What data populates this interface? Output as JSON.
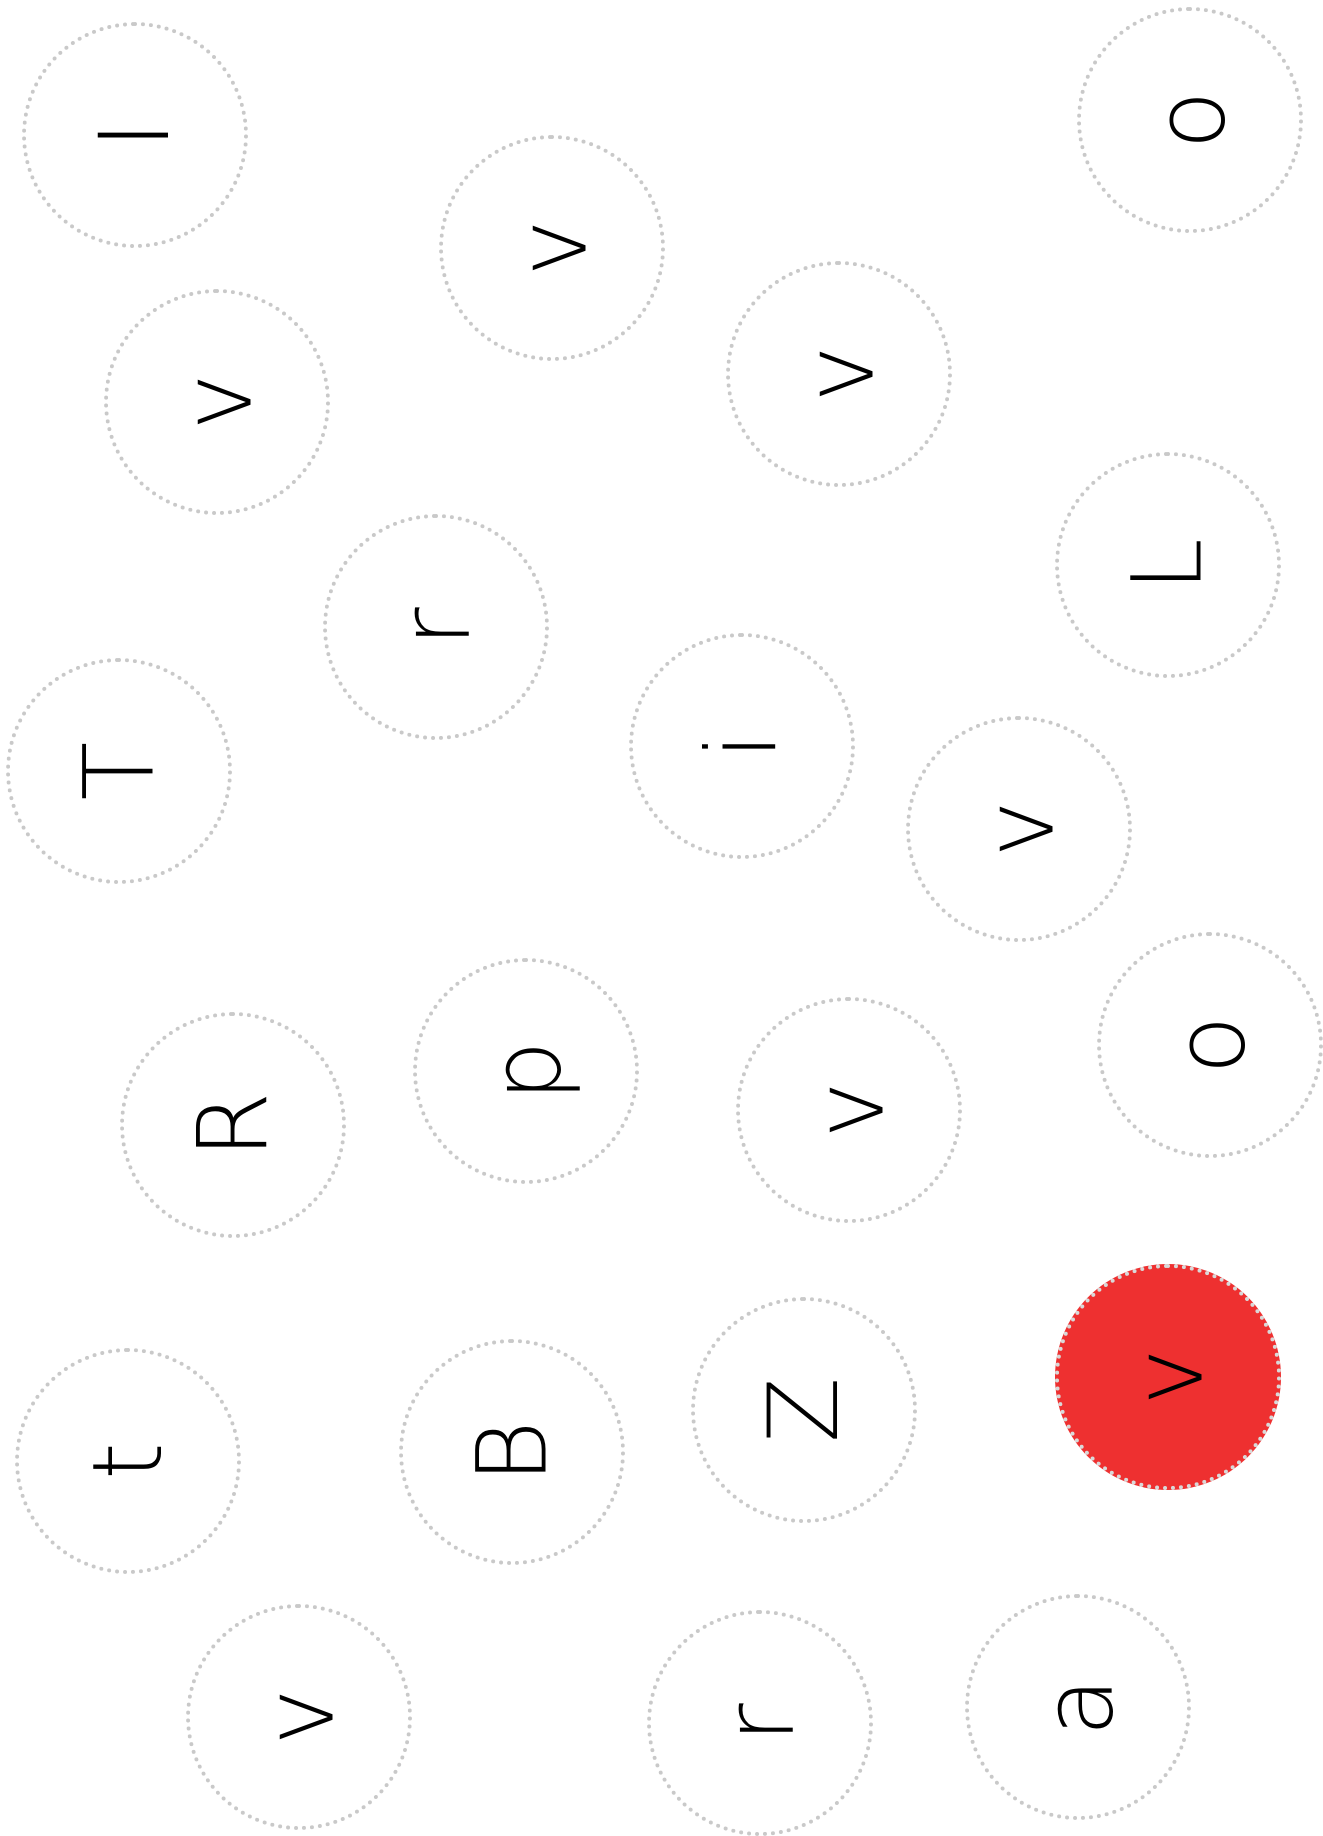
{
  "board": {
    "active_color": "#ee3030",
    "tiles": [
      {
        "letter": "I",
        "active": false
      },
      {
        "letter": "o",
        "active": false
      },
      {
        "letter": "v",
        "active": false
      },
      {
        "letter": "v",
        "active": false
      },
      {
        "letter": "v",
        "active": false
      },
      {
        "letter": "L",
        "active": false
      },
      {
        "letter": "r",
        "active": false
      },
      {
        "letter": "T",
        "active": false
      },
      {
        "letter": "i",
        "active": false
      },
      {
        "letter": "v",
        "active": false
      },
      {
        "letter": "o",
        "active": false
      },
      {
        "letter": "p",
        "active": false
      },
      {
        "letter": "R",
        "active": false
      },
      {
        "letter": "v",
        "active": false
      },
      {
        "letter": "v",
        "active": true
      },
      {
        "letter": "t",
        "active": false
      },
      {
        "letter": "B",
        "active": false
      },
      {
        "letter": "Z",
        "active": false
      },
      {
        "letter": "v",
        "active": false
      },
      {
        "letter": "r",
        "active": false
      },
      {
        "letter": "a",
        "active": false
      }
    ]
  }
}
